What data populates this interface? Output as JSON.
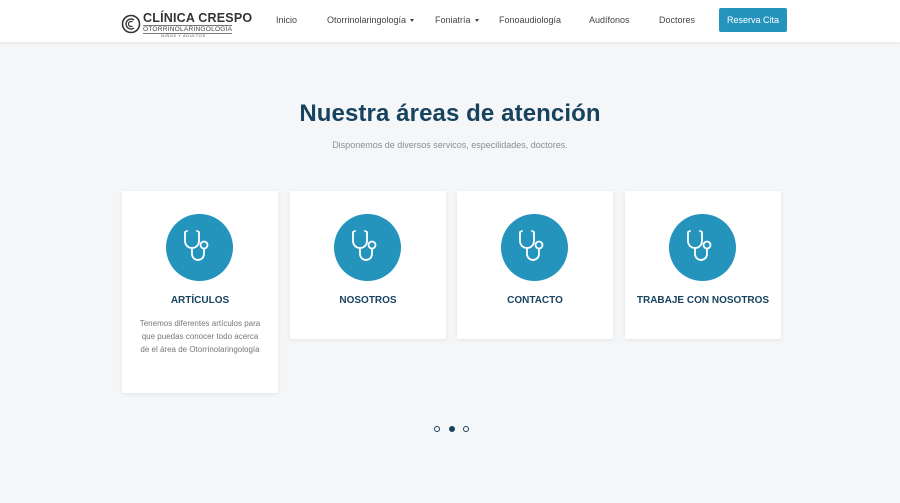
{
  "header": {
    "logo": {
      "title": "CLÍNICA CRESPO",
      "subtitle": "OTORRINOLARINGOLOGÍA",
      "tagline": "NIÑOS Y ADULTOS"
    },
    "nav": [
      {
        "label": "Inicio",
        "has_dropdown": false
      },
      {
        "label": "Otorrinolaringología",
        "has_dropdown": true
      },
      {
        "label": "Foniatría",
        "has_dropdown": true
      },
      {
        "label": "Fonoaudiología",
        "has_dropdown": false
      },
      {
        "label": "Audífonos",
        "has_dropdown": false
      },
      {
        "label": "Doctores",
        "has_dropdown": false
      }
    ],
    "cta_label": "Reserva Cita"
  },
  "section": {
    "title": "Nuestra áreas de atención",
    "subtitle": "Disponemos de diversos servicos, especilidades, doctores."
  },
  "cards": [
    {
      "title": "ARTÍCULOS",
      "text": "Tenemos diferentes artículos para que puedas conocer todo acerca de el área de Otorrinolaringología",
      "icon": "stethoscope-icon"
    },
    {
      "title": "NOSOTROS",
      "text": "",
      "icon": "stethoscope-icon"
    },
    {
      "title": "CONTACTO",
      "text": "",
      "icon": "stethoscope-icon"
    },
    {
      "title": "TRABAJE CON NOSOTROS",
      "text": "",
      "icon": "stethoscope-icon"
    }
  ],
  "carousel": {
    "pages": 3,
    "active_page": 2
  },
  "colors": {
    "accent": "#2594bd",
    "heading": "#17435e",
    "background": "#f4f6f8"
  }
}
